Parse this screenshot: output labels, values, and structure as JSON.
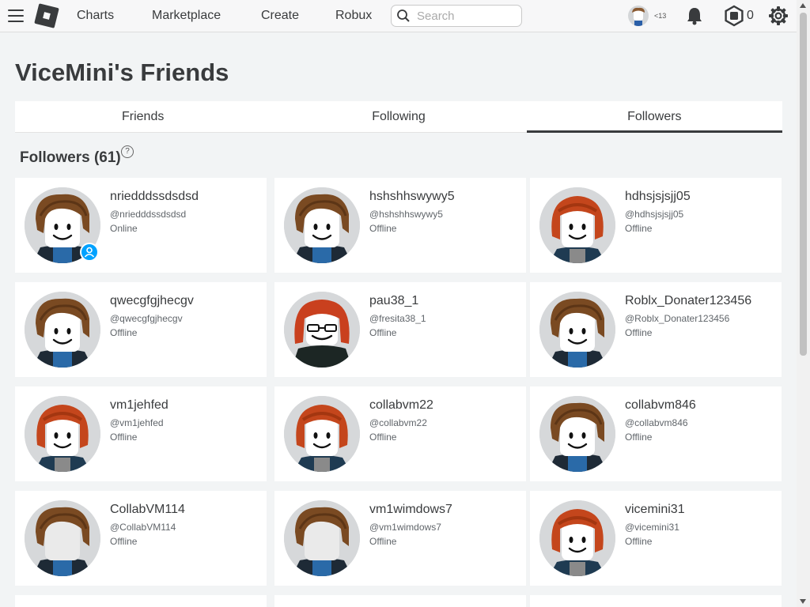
{
  "nav": {
    "links": [
      "Charts",
      "Marketplace",
      "Create",
      "Robux"
    ],
    "search_placeholder": "Search",
    "age_label": "<13",
    "robux_count": "0"
  },
  "page": {
    "title": "ViceMini's Friends",
    "tabs": [
      "Friends",
      "Following",
      "Followers"
    ],
    "active_tab": "Followers",
    "section_header": "Followers (61)",
    "help_glyph": "?"
  },
  "followers": [
    {
      "name": "nriedddssdsdsd",
      "handle": "@nriedddssdsdsd",
      "status": "Online",
      "avatar": "boy",
      "online": true
    },
    {
      "name": "hshshhswywy5",
      "handle": "@hshshhswywy5",
      "status": "Offline",
      "avatar": "boy"
    },
    {
      "name": "hdhsjsjsjj05",
      "handle": "@hdhsjsjsjj05",
      "status": "Offline",
      "avatar": "girl"
    },
    {
      "name": "qwecgfgjhecgv",
      "handle": "@qwecgfgjhecgv",
      "status": "Offline",
      "avatar": "boy"
    },
    {
      "name": "pau38_1",
      "handle": "@fresita38_1",
      "status": "Offline",
      "avatar": "glasses"
    },
    {
      "name": "Roblx_Donater123456",
      "handle": "@Roblx_Donater123456",
      "status": "Offline",
      "avatar": "boy"
    },
    {
      "name": "vm1jehfed",
      "handle": "@vm1jehfed",
      "status": "Offline",
      "avatar": "girl"
    },
    {
      "name": "collabvm22",
      "handle": "@collabvm22",
      "status": "Offline",
      "avatar": "girl"
    },
    {
      "name": "collabvm846",
      "handle": "@collabvm846",
      "status": "Offline",
      "avatar": "boy"
    },
    {
      "name": "CollabVM114",
      "handle": "@CollabVM114",
      "status": "Offline",
      "avatar": "boy-noface"
    },
    {
      "name": "vm1wimdows7",
      "handle": "@vm1wimdows7",
      "status": "Offline",
      "avatar": "boy-noface"
    },
    {
      "name": "vicemini31",
      "handle": "@vicemini31",
      "status": "Offline",
      "avatar": "girl"
    }
  ],
  "colors": {
    "accent": "#393b3d",
    "online": "#00a2ff",
    "background": "#f2f4f5"
  }
}
